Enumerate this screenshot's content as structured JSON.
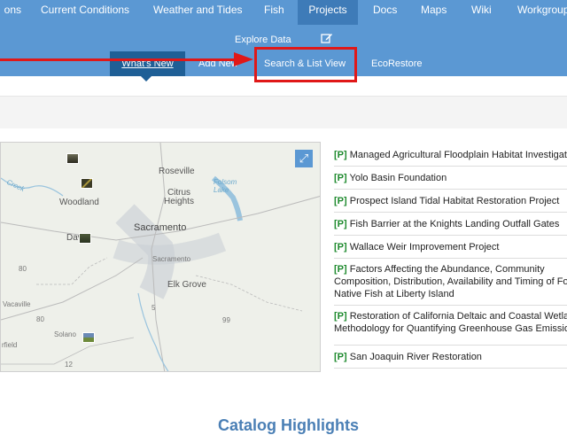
{
  "nav": {
    "items": [
      "ons",
      "Current Conditions",
      "Weather and Tides",
      "Fish",
      "Projects",
      "Docs",
      "Maps",
      "Wiki",
      "Workgroups"
    ],
    "active_index": 4,
    "explore_label": "Explore Data",
    "edit_icon": "edit-icon"
  },
  "subnav": {
    "items": [
      "What's New",
      "Add New",
      "Search & List View",
      "EcoRestore"
    ],
    "active_index": 0,
    "highlighted_index": 2
  },
  "annotation": {
    "color": "#e01818"
  },
  "map": {
    "labels": [
      "Roseville",
      "Folsom Lake",
      "Citrus Heights",
      "Woodland",
      "Sacramento",
      "Davis",
      "Sacramento",
      "Elk Grove",
      "Vacaville",
      "Solano",
      "rfield",
      "Creek",
      "80",
      "5",
      "99",
      "80",
      "12"
    ],
    "expand_icon": "expand-icon"
  },
  "projects": {
    "tag": "[P]",
    "items": [
      "Managed Agricultural Floodplain Habitat Investigation",
      "Yolo Basin Foundation",
      "Prospect Island Tidal Habitat Restoration Project",
      "Fish Barrier at the Knights Landing Outfall Gates",
      "Wallace Weir Improvement Project",
      "Factors Affecting the Abundance, Community Composition, Distribution, Availability and Timing of Food for Native Fish at Liberty Island",
      "Restoration of California Deltaic and Coastal Wetlands: Methodology for Quantifying Greenhouse Gas Emissions",
      "San Joaquin River Restoration"
    ]
  },
  "footer": {
    "title": "Catalog Highlights"
  },
  "colors": {
    "nav_bg": "#5b98d3",
    "nav_active": "#3e7bb8",
    "sub_active": "#1f5f96",
    "tag_green": "#1e8a2e"
  }
}
